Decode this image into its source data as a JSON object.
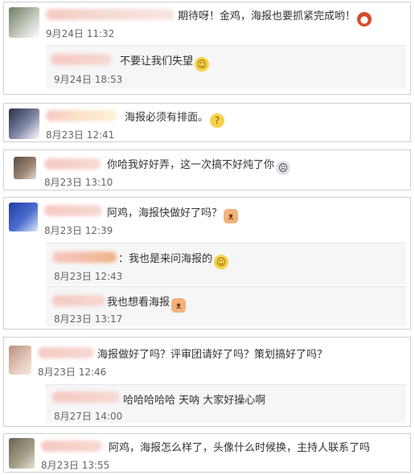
{
  "comments": [
    {
      "text": "期待呀！金鸡，海报也要抓紧完成哟！",
      "time": "9月24日 11:32",
      "replies": [
        {
          "text": "不要让我们失望",
          "time": "9月24日 18:53"
        }
      ]
    },
    {
      "text": "海报必须有排面。",
      "time": "8月23日 12:41",
      "replies": []
    },
    {
      "text": "你哈我好好弄，这一次搞不好炖了你",
      "time": "8月23日 13:10",
      "replies": []
    },
    {
      "text": "阿鸡，海报快做好了吗？",
      "time": "8月23日 12:39",
      "replies": [
        {
          "text": "：我也是来问海报的",
          "time": "8月23日 12:43"
        },
        {
          "text": "我也想看海报",
          "time": "8月23日 13:17"
        }
      ]
    },
    {
      "text": "海报做好了吗？评审团请好了吗？策划搞好了吗？",
      "time": "8月23日 12:46",
      "replies": [
        {
          "text": "哈哈哈哈哈 天呐 大家好操心啊",
          "time": "8月27日 14:00"
        }
      ]
    },
    {
      "text": "阿鸡，海报怎么样了，头像什么时候换，主持人联系了吗",
      "time": "8月23日 13:55",
      "replies": []
    }
  ],
  "emoji": {
    "c0": "red-chicken-emoji",
    "c0r0": "wink-smiley-emoji",
    "c1": "thinking-emoji",
    "c2": "crying-face-emoji",
    "c3": "cat-emoji",
    "c3r0": "smile-emoji",
    "c3r1": "cat-emoji"
  }
}
